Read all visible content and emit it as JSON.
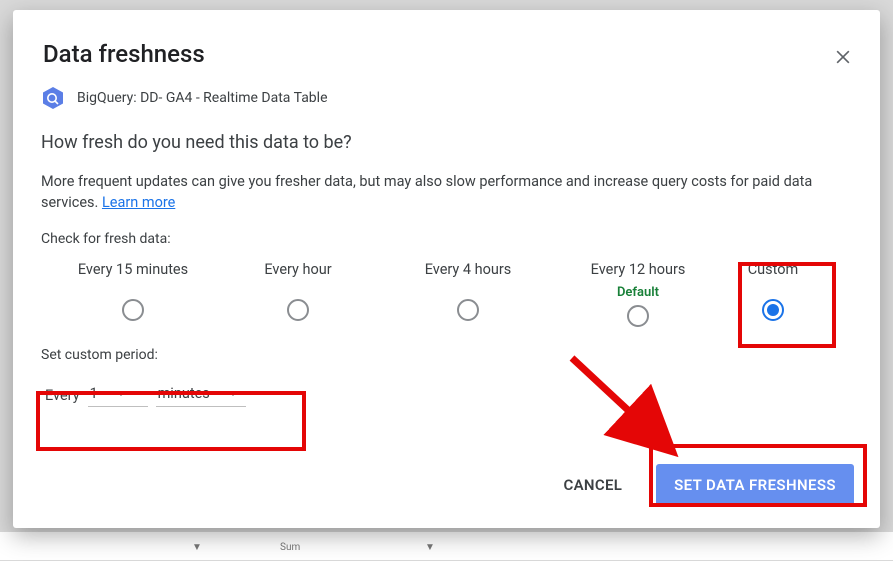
{
  "dialog": {
    "title": "Data freshness",
    "sourceLabel": "BigQuery: DD- GA4 - Realtime Data Table",
    "subhead": "How fresh do you need this data to be?",
    "description": "More frequent updates can give you fresher data, but may also slow performance and increase query costs for paid data services. ",
    "learnMore": "Learn more",
    "checkLabel": "Check for fresh data:",
    "options": {
      "m15": "Every 15 minutes",
      "hour": "Every hour",
      "h4": "Every 4 hours",
      "h12": "Every 12 hours",
      "defaultTag": "Default",
      "custom": "Custom"
    },
    "customLabel": "Set custom period:",
    "customEvery": "Every",
    "customValue": "1",
    "customUnit": "minutes",
    "cancel": "CANCEL",
    "submit": "SET DATA FRESHNESS"
  },
  "background": {
    "sum": "Sum"
  }
}
